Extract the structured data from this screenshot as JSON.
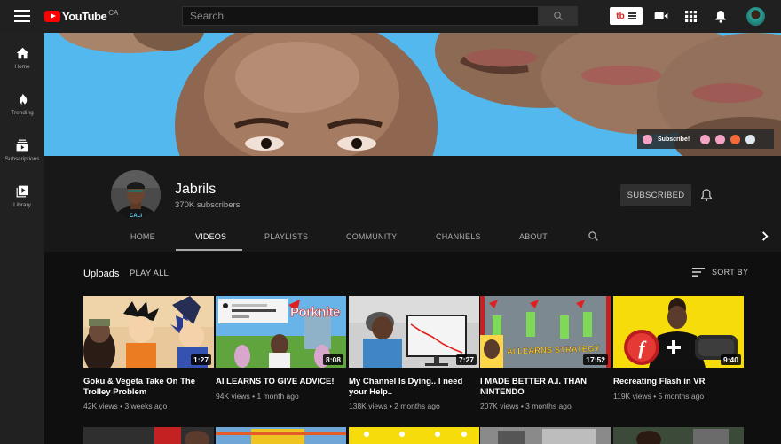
{
  "topbar": {
    "logo_text": "YouTube",
    "logo_region": "CA",
    "search_placeholder": "Search",
    "tb_badge": "tb"
  },
  "sidebar": {
    "items": [
      {
        "label": "Home",
        "icon": "home-icon"
      },
      {
        "label": "Trending",
        "icon": "flame-icon"
      },
      {
        "label": "Subscriptions",
        "icon": "subscriptions-icon"
      },
      {
        "label": "Library",
        "icon": "library-icon"
      }
    ]
  },
  "banner": {
    "link_label": "Subscribe!"
  },
  "channel": {
    "name": "Jabrils",
    "subscribers": "370K subscribers",
    "subscribe_button": "SUBSCRIBED",
    "avatar_caption": "CALI"
  },
  "tabs": [
    "HOME",
    "VIDEOS",
    "PLAYLISTS",
    "COMMUNITY",
    "CHANNELS",
    "ABOUT"
  ],
  "active_tab": "VIDEOS",
  "section": {
    "title": "Uploads",
    "play_all": "PLAY ALL",
    "sort": "SORT BY"
  },
  "videos": [
    {
      "title": "Goku & Vegeta Take On The Trolley Problem",
      "views": "42K views",
      "age": "3 weeks ago",
      "duration": "1:27"
    },
    {
      "title": "AI LEARNS TO GIVE ADVICE!",
      "views": "94K views",
      "age": "1 month ago",
      "duration": "8:08",
      "thumb_text": "Porknite"
    },
    {
      "title": "My Channel Is Dying.. I need your Help..",
      "views": "138K views",
      "age": "2 months ago",
      "duration": "7:27"
    },
    {
      "title": "I MADE BETTER A.I. THAN NINTENDO",
      "views": "207K views",
      "age": "3 months ago",
      "duration": "17:52",
      "thumb_text": "AI LEARNS STRATEGY"
    },
    {
      "title": "Recreating Flash in VR",
      "views": "119K views",
      "age": "5 months ago",
      "duration": "9:40"
    }
  ],
  "colors": {
    "brand_red": "#ff0000",
    "banner_sky": "#52b8ee",
    "flash_yellow": "#f5dc0a"
  }
}
